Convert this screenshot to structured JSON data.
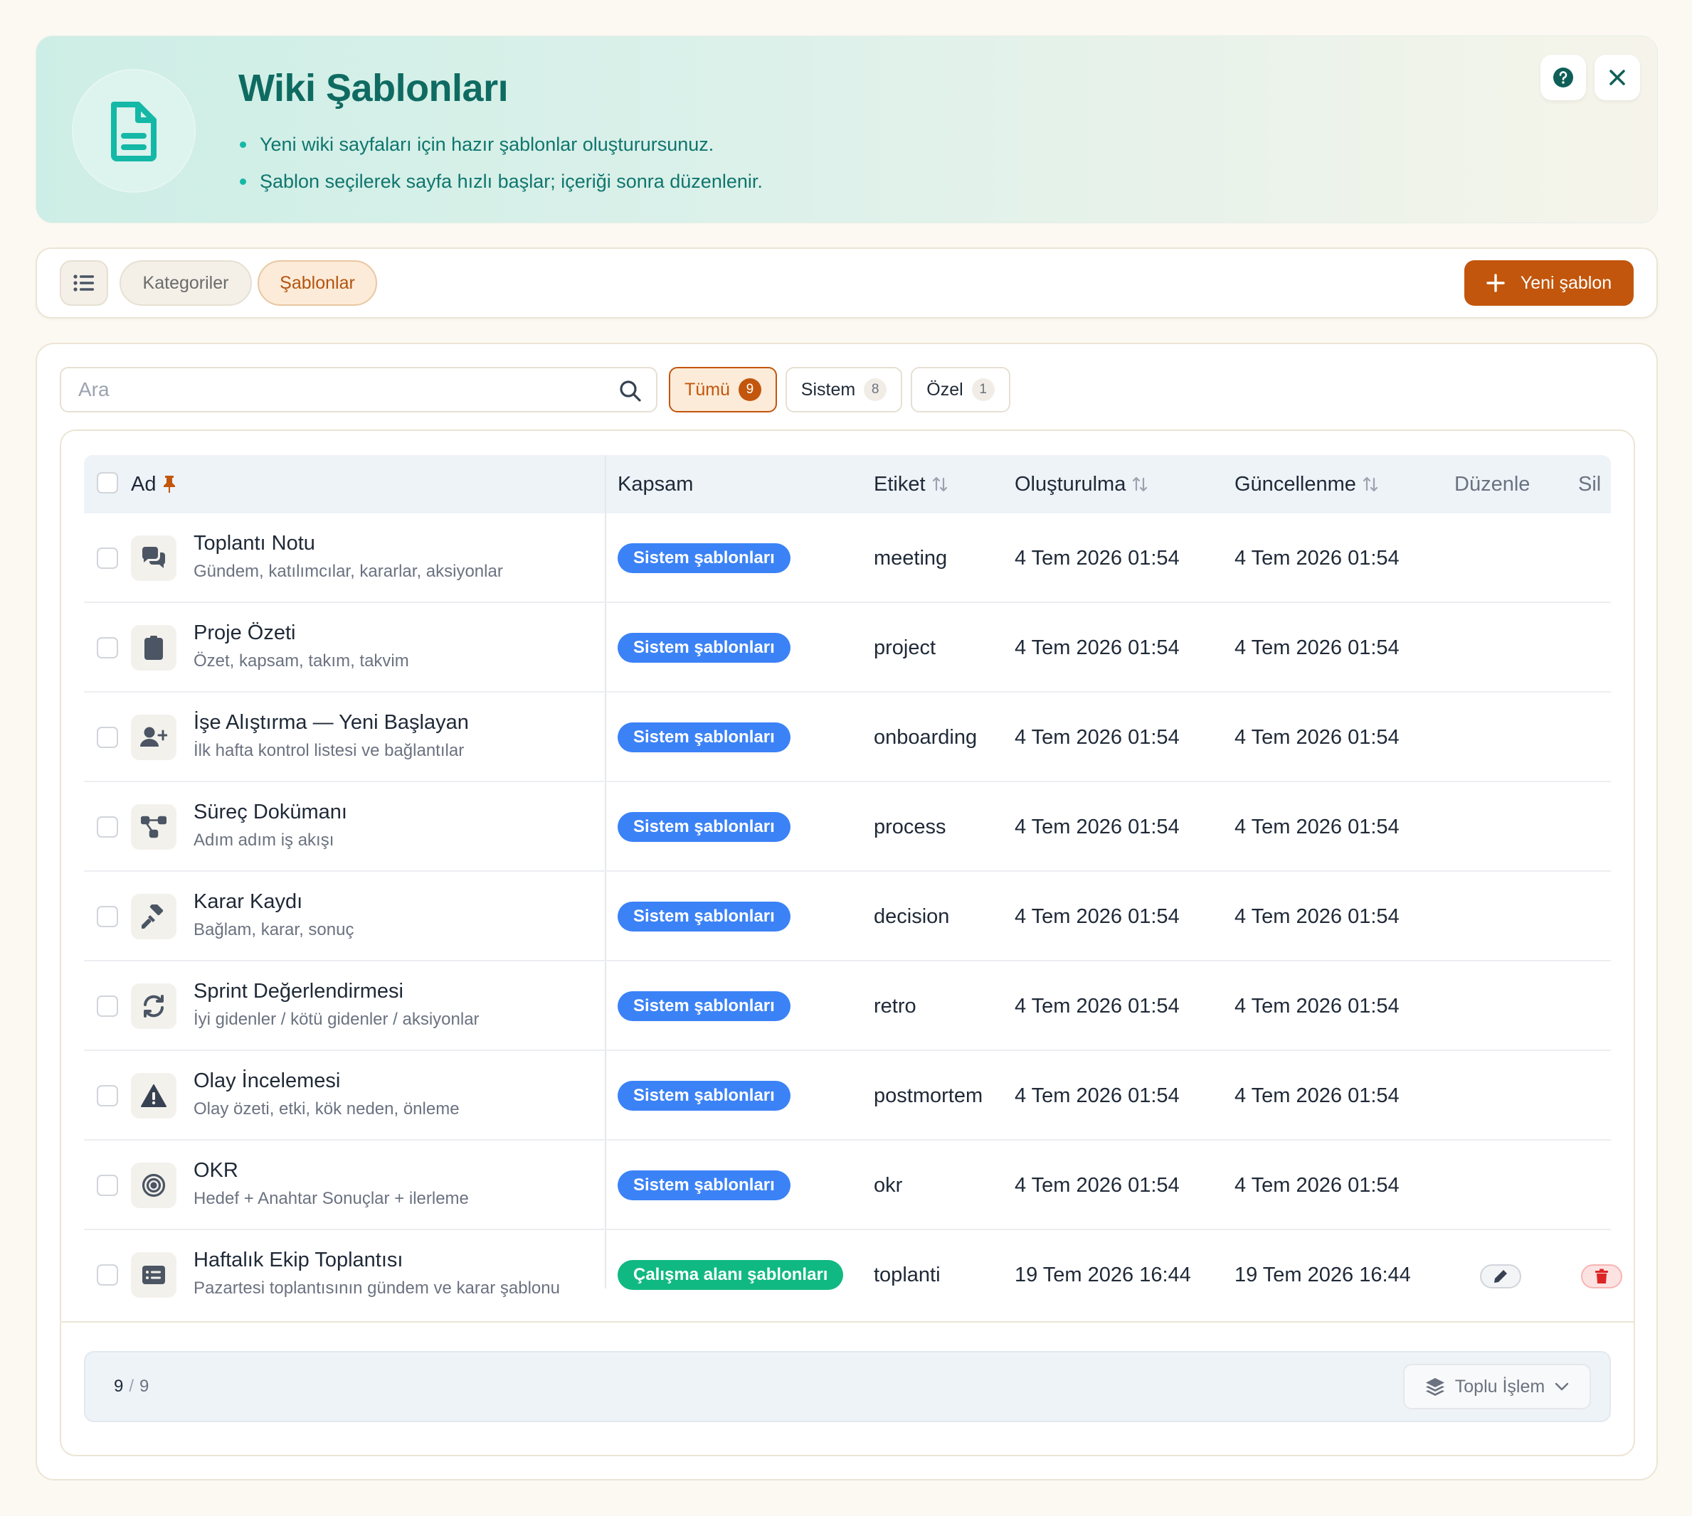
{
  "hero": {
    "title": "Wiki Şablonları",
    "bullets": [
      "Yeni wiki sayfaları için hazır şablonlar oluşturursunuz.",
      "Şablon seçilerek sayfa hızlı başlar; içeriği sonra düzenlenir."
    ],
    "icon": "document-icon"
  },
  "toolbar": {
    "tabs": [
      "Kategoriler",
      "Şablonlar"
    ],
    "active_tab": "Şablonlar",
    "new_label": "Yeni şablon"
  },
  "search": {
    "placeholder": "Ara",
    "value": ""
  },
  "filters": [
    {
      "label": "Tümü",
      "count": "9",
      "active": true
    },
    {
      "label": "Sistem",
      "count": "8"
    },
    {
      "label": "Özel",
      "count": "1"
    }
  ],
  "table": {
    "headers": {
      "name": "Ad",
      "scope": "Kapsam",
      "tag": "Etiket",
      "created": "Oluşturulma",
      "updated": "Güncellenme",
      "edit": "Düzenle",
      "delete": "Sil"
    },
    "rows": [
      {
        "icon": "chat-bubbles-icon",
        "title": "Toplantı Notu",
        "desc": "Gündem, katılımcılar, kararlar, aksiyonlar",
        "scope": "Sistem şablonları",
        "tag": "meeting",
        "created": "4 Tem 2026 01:54",
        "updated": "4 Tem 2026 01:54"
      },
      {
        "icon": "clipboard-icon",
        "title": "Proje Özeti",
        "desc": "Özet, kapsam, takım, takvim",
        "scope": "Sistem şablonları",
        "tag": "project",
        "created": "4 Tem 2026 01:54",
        "updated": "4 Tem 2026 01:54"
      },
      {
        "icon": "user-plus-icon",
        "title": "İşe Alıştırma — Yeni Başlayan",
        "desc": "İlk hafta kontrol listesi ve bağlantılar",
        "scope": "Sistem şablonları",
        "tag": "onboarding",
        "created": "4 Tem 2026 01:54",
        "updated": "4 Tem 2026 01:54"
      },
      {
        "icon": "flow-diagram-icon",
        "title": "Süreç Dokümanı",
        "desc": "Adım adım iş akışı",
        "scope": "Sistem şablonları",
        "tag": "process",
        "created": "4 Tem 2026 01:54",
        "updated": "4 Tem 2026 01:54"
      },
      {
        "icon": "gavel-icon",
        "title": "Karar Kaydı",
        "desc": "Bağlam, karar, sonuç",
        "scope": "Sistem şablonları",
        "tag": "decision",
        "created": "4 Tem 2026 01:54",
        "updated": "4 Tem 2026 01:54"
      },
      {
        "icon": "refresh-icon",
        "title": "Sprint Değerlendirmesi",
        "desc": "İyi gidenler / kötü gidenler / aksiyonlar",
        "scope": "Sistem şablonları",
        "tag": "retro",
        "created": "4 Tem 2026 01:54",
        "updated": "4 Tem 2026 01:54"
      },
      {
        "icon": "warning-icon",
        "title": "Olay İncelemesi",
        "desc": "Olay özeti, etki, kök neden, önleme",
        "scope": "Sistem şablonları",
        "tag": "postmortem",
        "created": "4 Tem 2026 01:54",
        "updated": "4 Tem 2026 01:54"
      },
      {
        "icon": "target-icon",
        "title": "OKR",
        "desc": "Hedef + Anahtar Sonuçlar + ilerleme",
        "scope": "Sistem şablonları",
        "tag": "okr",
        "created": "4 Tem 2026 01:54",
        "updated": "4 Tem 2026 01:54"
      },
      {
        "icon": "card-list-icon",
        "title": "Haftalık Ekip Toplantısı",
        "desc": "Pazartesi toplantısının gündem ve karar şablonu",
        "scope": "Çalışma alanı şablonları",
        "tag": "toplanti",
        "created": "19 Tem 2026 16:44",
        "updated": "19 Tem 2026 16:44",
        "editable": true
      }
    ]
  },
  "footer": {
    "shown": "9",
    "total": "9",
    "bulk_label": "Toplu İşlem"
  },
  "colors": {
    "accent": "#c2560c",
    "teal": "#0f6b62",
    "system_badge": "#3b82f6",
    "workspace_badge": "#10b981"
  }
}
